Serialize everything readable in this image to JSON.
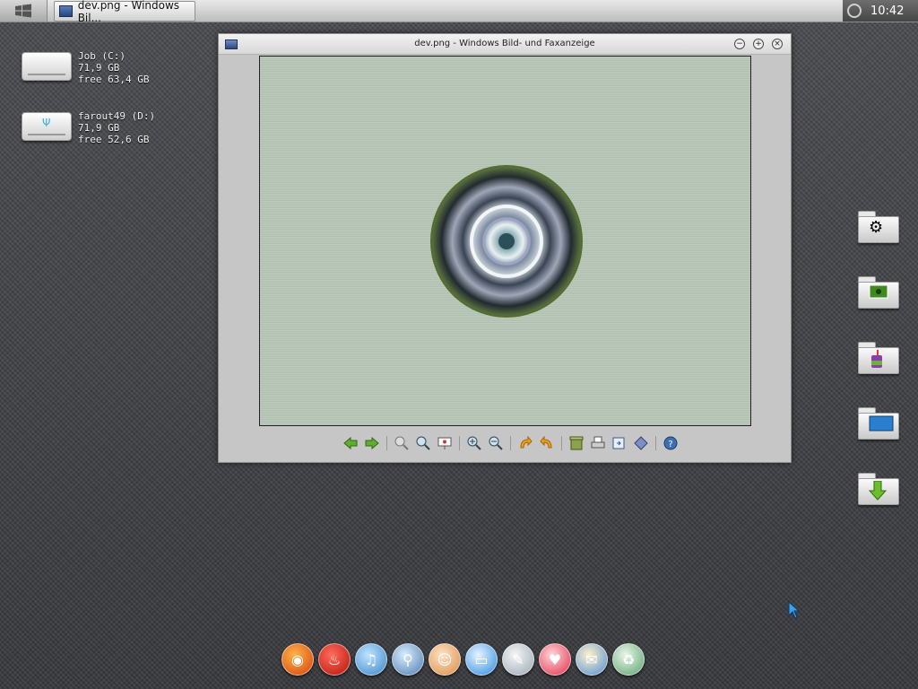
{
  "taskbar": {
    "start_icon": "windows-logo-icon",
    "task_title": "dev.png - Windows Bil...",
    "clock": "10:42"
  },
  "desktop": {
    "drives": [
      {
        "name": "Job (C:)",
        "size": "71,9 GB",
        "free": "free 63,4 GB",
        "icon": "hard-drive-icon"
      },
      {
        "name": "farout49 (D:)",
        "size": "71,9 GB",
        "free": "free 52,6 GB",
        "icon": "usb-drive-icon"
      }
    ],
    "right_folders": [
      "settings-folder-icon",
      "pictures-folder-icon",
      "drinks-folder-icon",
      "window-folder-icon",
      "downloads-folder-icon"
    ]
  },
  "window": {
    "title": "dev.png - Windows Bild- und Faxanzeige",
    "toolbar": [
      "previous-image-icon",
      "next-image-icon",
      "best-fit-icon",
      "actual-size-icon",
      "slideshow-icon",
      "zoom-in-icon",
      "zoom-out-icon",
      "rotate-clockwise-icon",
      "rotate-counterclockwise-icon",
      "delete-icon",
      "print-icon",
      "copy-to-icon",
      "open-for-editing-icon",
      "help-icon"
    ]
  },
  "dock": {
    "items": [
      "firefox-icon",
      "burn-icon",
      "music-icon",
      "joystick-icon",
      "hamster-icon",
      "monitor-icon",
      "paint-icon",
      "heart-icon",
      "mail-icon",
      "recycle-bin-icon"
    ]
  },
  "colors": {
    "desktop": "#3e3f43",
    "viewer_bg": "#b8c8b8",
    "accent_blue": "#3ab0e6"
  }
}
